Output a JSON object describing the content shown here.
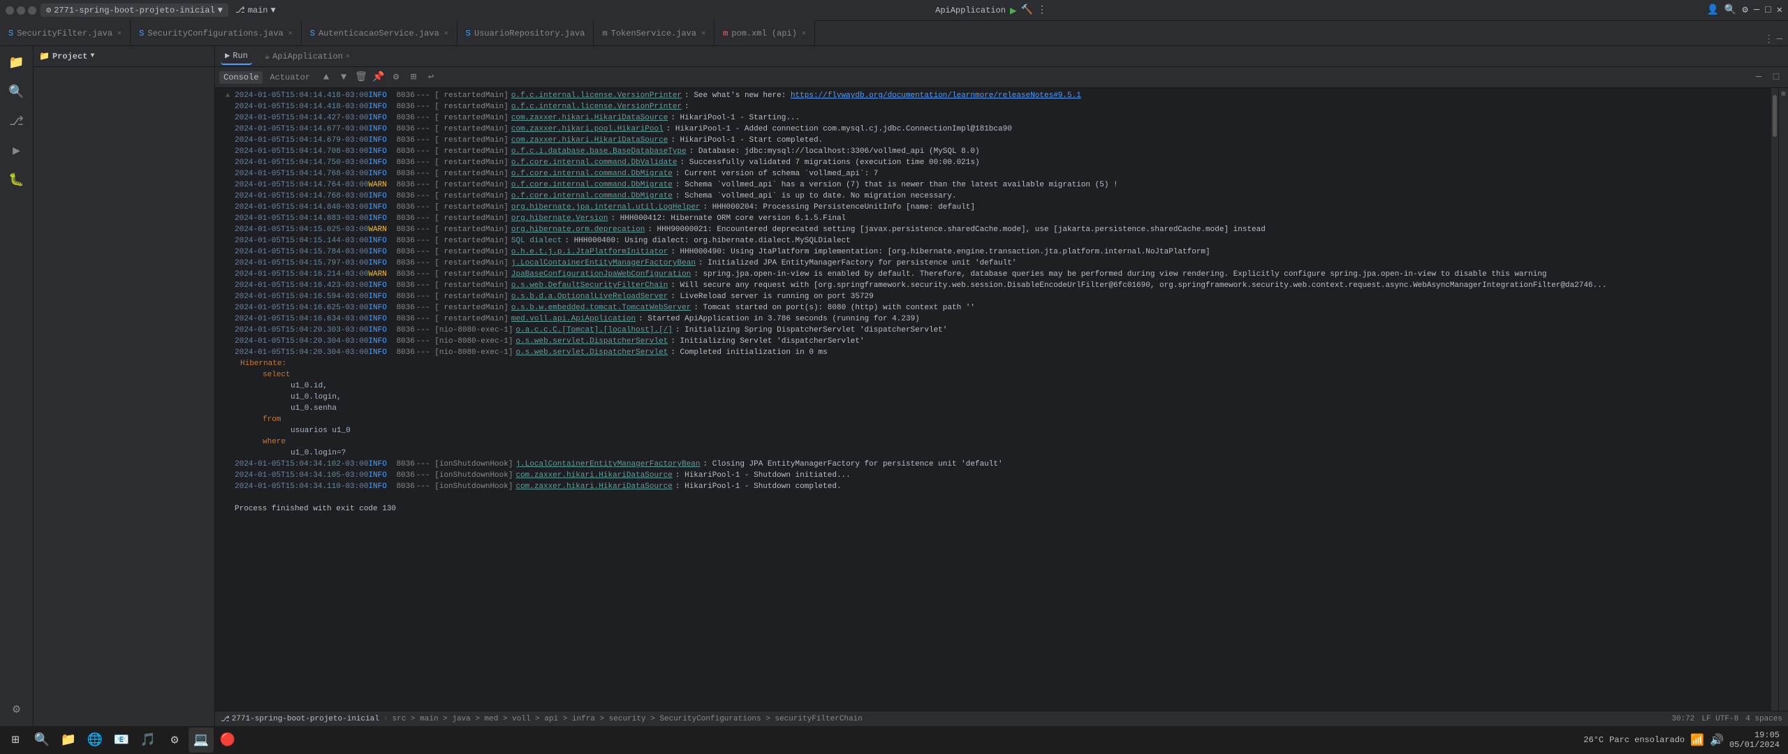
{
  "titleBar": {
    "projectLabel": "2771-spring-boot-projeto-inicial",
    "branchLabel": "main",
    "appLabel": "ApiApplication",
    "searchPlaceholder": "Search",
    "windowTitle": "ApiApplication"
  },
  "tabs": [
    {
      "id": "security-filter",
      "label": "SecurityFilter.java",
      "icon": "S",
      "iconColor": "#4a9eff",
      "active": false
    },
    {
      "id": "security-config",
      "label": "SecurityConfigurations.java",
      "icon": "S",
      "iconColor": "#4a9eff",
      "active": false
    },
    {
      "id": "autenticacao-service",
      "label": "AutenticacaoService.java",
      "icon": "S",
      "iconColor": "#4a9eff",
      "active": false
    },
    {
      "id": "usuario-repository",
      "label": "UsuarioRepository.java",
      "icon": "S",
      "iconColor": "#4a9eff",
      "active": false
    },
    {
      "id": "token-service",
      "label": "TokenService.java",
      "icon": "m",
      "iconColor": "#4a9eff",
      "active": false
    },
    {
      "id": "pom-xml",
      "label": "pom.xml (api)",
      "icon": "m",
      "iconColor": "#e06c75",
      "active": false
    }
  ],
  "runBar": {
    "runLabel": "Run",
    "appLabel": "ApiApplication"
  },
  "consoleTabs": {
    "consoleLabel": "Console",
    "actuatorLabel": "Actuator"
  },
  "logLines": [
    {
      "time": "2024-01-05T15:04:14.418-03:00",
      "level": "INFO",
      "pid": "8036",
      "thread": "---  [  restartedMain]",
      "class": "o.f.c.internal.license.VersionPrinter",
      "message": ": See what's new here: https://flywaydb.org/documentation/learnmore/releaseNotes#9.5.1"
    },
    {
      "time": "2024-01-05T15:04:14.418-03:00",
      "level": "INFO",
      "pid": "8036",
      "thread": "---  [  restartedMain]",
      "class": "o.f.c.internal.license.VersionPrinter",
      "message": ":"
    },
    {
      "time": "2024-01-05T15:04:14.427-03:00",
      "level": "INFO",
      "pid": "8036",
      "thread": "---  [  restartedMain]",
      "class": "com.zaxxer.hikari.HikariDataSource",
      "message": ": HikariPool-1 - Starting..."
    },
    {
      "time": "2024-01-05T15:04:14.677-03:00",
      "level": "INFO",
      "pid": "8036",
      "thread": "---  [  restartedMain]",
      "class": "com.zaxxer.hikari.pool.HikariPool",
      "message": ": HikariPool-1 - Added connection com.mysql.cj.jdbc.ConnectionImpl@181bca90"
    },
    {
      "time": "2024-01-05T15:04:14.679-03:00",
      "level": "INFO",
      "pid": "8036",
      "thread": "---  [  restartedMain]",
      "class": "com.zaxxer.hikari.HikariDataSource",
      "message": ": HikariPool-1 - Start completed."
    },
    {
      "time": "2024-01-05T15:04:14.708-03:00",
      "level": "INFO",
      "pid": "8036",
      "thread": "---  [  restartedMain]",
      "class": "o.f.c.i.database.base.BaseDatabaseType",
      "message": ": Database: jdbc:mysql://localhost:3306/vollmed_api (MySQL 8.0)"
    },
    {
      "time": "2024-01-05T15:04:14.750-03:00",
      "level": "INFO",
      "pid": "8036",
      "thread": "---  [  restartedMain]",
      "class": "o.f.core.internal.command.DbValidate",
      "message": ": Successfully validated 7 migrations (execution time 00:00.021s)"
    },
    {
      "time": "2024-01-05T15:04:14.768-03:00",
      "level": "INFO",
      "pid": "8036",
      "thread": "---  [  restartedMain]",
      "class": "o.f.core.internal.command.DbMigrate",
      "message": ": Current version of schema `vollmed_api`: 7"
    },
    {
      "time": "2024-01-05T15:04:14.764-03:00",
      "level": "WARN",
      "pid": "8036",
      "thread": "---  [  restartedMain]",
      "class": "o.f.core.internal.command.DbMigrate",
      "message": ": Schema `vollmed_api` has a version (7) that is newer than the latest available migration (5) !"
    },
    {
      "time": "2024-01-05T15:04:14.768-03:00",
      "level": "INFO",
      "pid": "8036",
      "thread": "---  [  restartedMain]",
      "class": "o.f.core.internal.command.DbMigrate",
      "message": ": Schema `vollmed_api` is up to date. No migration necessary."
    },
    {
      "time": "2024-01-05T15:04:14.840-03:00",
      "level": "INFO",
      "pid": "8036",
      "thread": "---  [  restartedMain]",
      "class": "org.hibernate.jpa.internal.util.LogHelper",
      "message": ": HHH000204: Processing PersistenceUnitInfo [name: default]"
    },
    {
      "time": "2024-01-05T15:04:14.883-03:00",
      "level": "INFO",
      "pid": "8036",
      "thread": "---  [  restartedMain]",
      "class": "org.hibernate.Version",
      "message": ": HHH000412: Hibernate ORM core version 6.1.5.Final"
    },
    {
      "time": "2024-01-05T15:04:15.025-03:00",
      "level": "WARN",
      "pid": "8036",
      "thread": "---  [  restartedMain]",
      "class": "org.hibernate.orm.deprecation",
      "message": ": HHH90000021: Encountered deprecated setting [javax.persistence.sharedCache.mode], use [jakarta.persistence.sharedCache.mode] instead"
    },
    {
      "time": "2024-01-05T15:04:15.144-03:00",
      "level": "INFO",
      "pid": "8036",
      "thread": "---  [  restartedMain]",
      "class": "SQL dialect",
      "message": ": HHH000400: Using dialect: org.hibernate.dialect.MySQLDialect"
    },
    {
      "time": "2024-01-05T15:04:15.784-03:00",
      "level": "INFO",
      "pid": "8036",
      "thread": "---  [  restartedMain]",
      "class": "o.h.e.t.j.p.i.JtaPlatformInitiator",
      "message": ": HHH000490: Using JtaPlatform implementation: [org.hibernate.engine.transaction.jta.platform.internal.NoJtaPlatform]"
    },
    {
      "time": "2024-01-05T15:04:15.797-03:00",
      "level": "INFO",
      "pid": "8036",
      "thread": "---  [  restartedMain]",
      "class": "j.LocalContainerEntityManagerFactoryBean",
      "message": ": Initialized JPA EntityManagerFactory for persistence unit 'default'"
    },
    {
      "time": "2024-01-05T15:04:16.214-03:00",
      "level": "WARN",
      "pid": "8036",
      "thread": "---  [  restartedMain]",
      "class": "JpaBaseConfigurationJpaWebConfiguration",
      "message": ": spring.jpa.open-in-view is enabled by default. Therefore, database queries may be performed during view rendering. Explicitly configure spring.jpa.open-in-view to disable this warning"
    },
    {
      "time": "2024-01-05T15:04:16.423-03:00",
      "level": "INFO",
      "pid": "8036",
      "thread": "---  [  restartedMain]",
      "class": "o.s.web.DefaultSecurityFilterChain",
      "message": ": Will secure any request with [org.springframework.security.web.session.DisableEncodeUrlFilter@6fc01690, org.springframework.security.web.context.request.async.WebAsyncManagerIntegrationFilter@da2746..."
    },
    {
      "time": "2024-01-05T15:04:16.594-03:00",
      "level": "INFO",
      "pid": "8036",
      "thread": "---  [  restartedMain]",
      "class": "o.s.b.d.a.OptionalLiveReloadServer",
      "message": ": LiveReload server is running on port 35729"
    },
    {
      "time": "2024-01-05T15:04:16.625-03:00",
      "level": "INFO",
      "pid": "8036",
      "thread": "---  [  restartedMain]",
      "class": "o.s.b.w.embedded.tomcat.TomcatWebServer",
      "message": ": Tomcat started on port(s): 8080 (http) with context path ''"
    },
    {
      "time": "2024-01-05T15:04:16.634-03:00",
      "level": "INFO",
      "pid": "8036",
      "thread": "---  [  restartedMain]",
      "class": "med.voll.api.ApiApplication",
      "message": ": Started ApiApplication in 3.786 seconds (running for 4.239)"
    },
    {
      "time": "2024-01-05T15:04:20.303-03:00",
      "level": "INFO",
      "pid": "8036",
      "thread": "--- [nio-8080-exec-1]",
      "class": "o.a.c.c.C.[Tomcat].[localhost].[/]",
      "message": ": Initializing Spring DispatcherServlet 'dispatcherServlet'"
    },
    {
      "time": "2024-01-05T15:04:20.304-03:00",
      "level": "INFO",
      "pid": "8036",
      "thread": "--- [nio-8080-exec-1]",
      "class": "o.s.web.servlet.DispatcherServlet",
      "message": ": Initializing Servlet 'dispatcherServlet'"
    },
    {
      "time": "2024-01-05T15:04:20.304-03:00",
      "level": "INFO",
      "pid": "8036",
      "thread": "--- [nio-8080-exec-1]",
      "class": "o.s.web.servlet.DispatcherServlet",
      "message": ": Completed initialization in 0 ms"
    }
  ],
  "hibernateBlock": {
    "label": "Hibernate:",
    "query": "select\n    u1_0.id,\n    u1_0.login,\n    u1_0.senha\nfrom\n    usuarios u1_0\nwhere\n    u1_0.login=?"
  },
  "shutdownLines": [
    {
      "time": "2024-01-05T15:04:34.102-03:00",
      "level": "INFO",
      "pid": "8036",
      "thread": "---  [ionShutdownHook]",
      "class": "j.LocalContainerEntityManagerFactoryBean",
      "message": ": Closing JPA EntityManagerFactory for persistence unit 'default'"
    },
    {
      "time": "2024-01-05T15:04:34.105-03:00",
      "level": "INFO",
      "pid": "8036",
      "thread": "---  [ionShutdownHook]",
      "class": "com.zaxxer.hikari.HikariDataSource",
      "message": ": HikariPool-1 - Shutdown initiated..."
    },
    {
      "time": "2024-01-05T15:04:34.110-03:00",
      "level": "INFO",
      "pid": "8036",
      "thread": "---  [ionShutdownHook]",
      "class": "com.zaxxer.hikari.HikariDataSource",
      "message": ": HikariPool-1 - Shutdown completed."
    }
  ],
  "exitMessage": "Process finished with exit code 130",
  "statusBar": {
    "branch": "2771-spring-boot-projeto-inicial",
    "path": "src > main > java > med > voll > api > infra > security > SecurityConfigurations > securityFilterChain",
    "position": "30:72",
    "encoding": "LF  UTF-8",
    "spaces": "4 spaces"
  },
  "taskbar": {
    "time": "19:05",
    "date": "05/01/2024",
    "temp": "26°C",
    "network": "Parc ensolarado"
  },
  "sidebarIcons": [
    {
      "id": "folder",
      "symbol": "📁"
    },
    {
      "id": "search",
      "symbol": "🔍"
    },
    {
      "id": "git",
      "symbol": "⎇"
    },
    {
      "id": "debug",
      "symbol": "🐛"
    },
    {
      "id": "extensions",
      "symbol": "⊞"
    }
  ]
}
